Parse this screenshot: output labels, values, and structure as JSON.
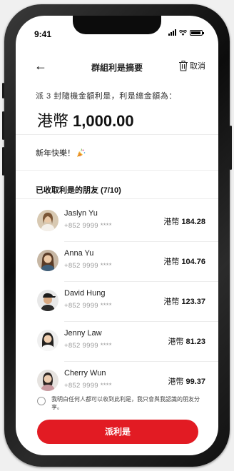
{
  "status_bar": {
    "time": "9:41"
  },
  "header": {
    "title": "群組利是摘要",
    "cancel_label": "取消"
  },
  "summary": {
    "description": "派 3 封隨機金額利是，利是總金額為：",
    "currency": "港幣",
    "total": "1,000.00"
  },
  "message": {
    "text": "新年快樂！"
  },
  "friends_section": {
    "title": "已收取利是的朋友 (7/10)"
  },
  "friends": [
    {
      "name": "Jaslyn Yu",
      "phone": "+852 9999 ****",
      "currency": "港幣",
      "amount": "184.28"
    },
    {
      "name": "Anna Yu",
      "phone": "+852 9999 ****",
      "currency": "港幣",
      "amount": "104.76"
    },
    {
      "name": "David Hung",
      "phone": "+852 9999 ****",
      "currency": "港幣",
      "amount": "123.37"
    },
    {
      "name": "Jenny Law",
      "phone": "+852 9999 ****",
      "currency": "港幣",
      "amount": "81.23"
    },
    {
      "name": "Cherry Wun",
      "phone": "+852 9999 ****",
      "currency": "港幣",
      "amount": "99.37"
    }
  ],
  "consent": {
    "text": "我明白任何人都可以收到此利是，我只會與我認識的朋友分享。"
  },
  "primary_button": {
    "label": "派利是"
  },
  "colors": {
    "accent": "#e21b23"
  }
}
